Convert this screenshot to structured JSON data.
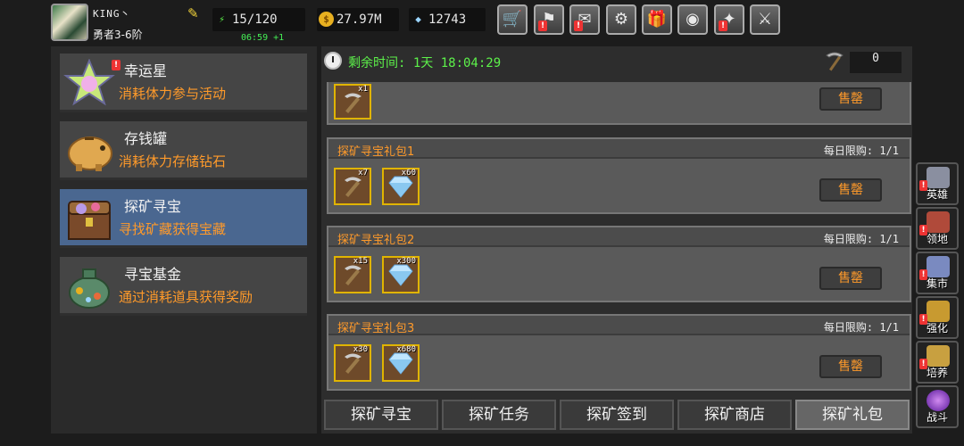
{
  "player": {
    "name": "KING丶",
    "rank": "勇者3-6阶"
  },
  "resources": {
    "energy": "15/120",
    "energy_timer": "06:59 +1",
    "gold": "27.97M",
    "gems": "12743"
  },
  "toolbar": {
    "icons": [
      "shop-cart-icon",
      "battle-flag-icon",
      "mail-icon",
      "gear-icon",
      "gift-icon",
      "color-wheel-icon",
      "spellbook-icon",
      "swords-icon"
    ]
  },
  "categories": [
    {
      "title": "幸运星",
      "desc": "消耗体力参与活动"
    },
    {
      "title": "存钱罐",
      "desc": "消耗体力存储钻石"
    },
    {
      "title": "探矿寻宝",
      "desc": "寻找矿藏获得宝藏"
    },
    {
      "title": "寻宝基金",
      "desc": "通过消耗道具获得奖励"
    }
  ],
  "main": {
    "remaining": "剩余时间: 1天 18:04:29",
    "pickaxe_count": "0",
    "buy_label": "售罄",
    "top_qty": "x1",
    "packs": [
      {
        "name": "探矿寻宝礼包1",
        "limit": "每日限购: 1/1",
        "pick_qty": "x7",
        "gem_qty": "x60"
      },
      {
        "name": "探矿寻宝礼包2",
        "limit": "每日限购: 1/1",
        "pick_qty": "x15",
        "gem_qty": "x300"
      },
      {
        "name": "探矿寻宝礼包3",
        "limit": "每日限购: 1/1",
        "pick_qty": "x30",
        "gem_qty": "x680"
      }
    ],
    "tabs": [
      "探矿寻宝",
      "探矿任务",
      "探矿签到",
      "探矿商店",
      "探矿礼包"
    ]
  },
  "rail": [
    {
      "label": "英雄",
      "icon": "helmet-icon",
      "color": "#8a8fa0"
    },
    {
      "label": "领地",
      "icon": "castle-icon",
      "color": "#b04a3a"
    },
    {
      "label": "集市",
      "icon": "market-icon",
      "color": "#7a8ac0"
    },
    {
      "label": "强化",
      "icon": "upgrade-icon",
      "color": "#c89a30"
    },
    {
      "label": "培养",
      "icon": "trophy-icon",
      "color": "#c8a040"
    },
    {
      "label": "战斗",
      "icon": "portal-icon",
      "color": "#9a3ad8"
    }
  ]
}
